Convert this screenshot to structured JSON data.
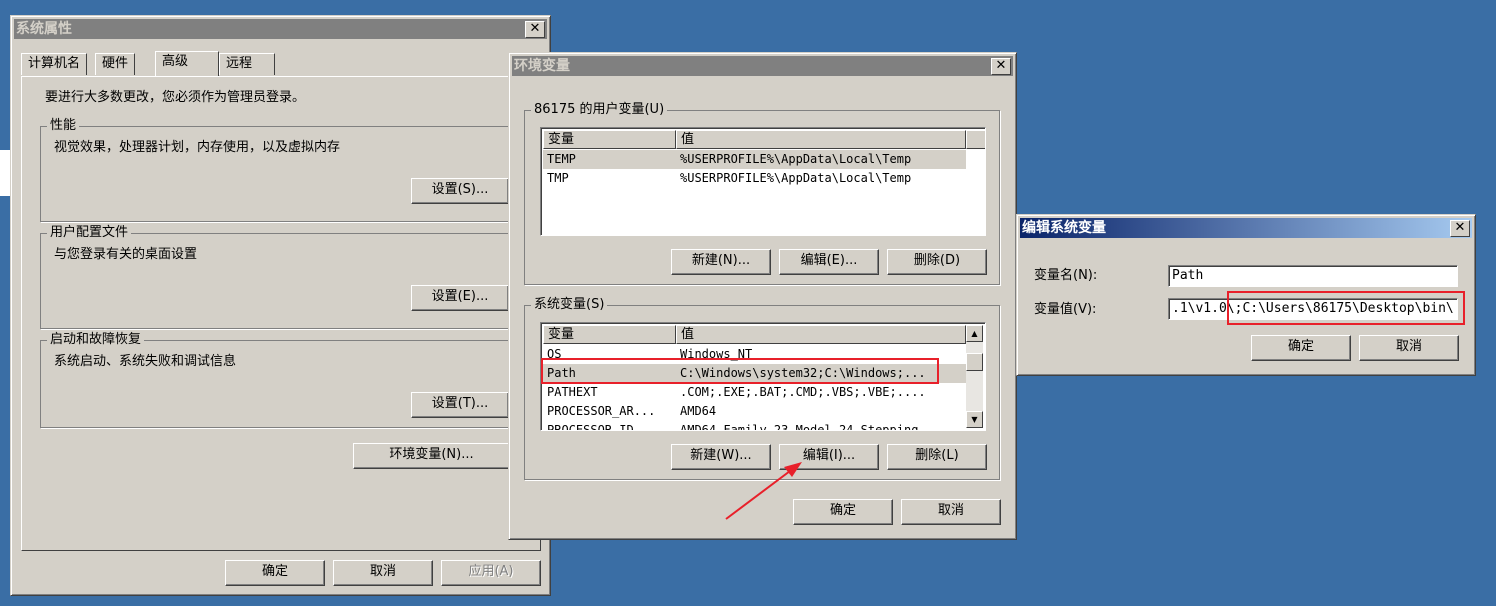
{
  "sysprops": {
    "title": "系统属性",
    "tabs": [
      "计算机名",
      "硬件",
      "高级",
      "远程"
    ],
    "admin_note": "要进行大多数更改，您必须作为管理员登录。",
    "perf": {
      "label": "性能",
      "desc": "视觉效果，处理器计划，内存使用，以及虚拟内存",
      "button": "设置(S)..."
    },
    "profile": {
      "label": "用户配置文件",
      "desc": "与您登录有关的桌面设置",
      "button": "设置(E)..."
    },
    "startup": {
      "label": "启动和故障恢复",
      "desc": "系统启动、系统失败和调试信息",
      "button": "设置(T)..."
    },
    "envvars_button": "环境变量(N)...",
    "ok": "确定",
    "cancel": "取消",
    "apply": "应用(A)"
  },
  "envvars": {
    "title": "环境变量",
    "user_group": "86175 的用户变量(U)",
    "columns": [
      "变量",
      "值"
    ],
    "user_vars": [
      {
        "name": "TEMP",
        "value": "%USERPROFILE%\\AppData\\Local\\Temp"
      },
      {
        "name": "TMP",
        "value": "%USERPROFILE%\\AppData\\Local\\Temp"
      }
    ],
    "user_buttons": {
      "new": "新建(N)...",
      "edit": "编辑(E)...",
      "delete": "删除(D)"
    },
    "sys_group": "系统变量(S)",
    "sys_vars": [
      {
        "name": "OS",
        "value": "Windows_NT"
      },
      {
        "name": "Path",
        "value": "C:\\Windows\\system32;C:\\Windows;..."
      },
      {
        "name": "PATHEXT",
        "value": ".COM;.EXE;.BAT;.CMD;.VBS;.VBE;...."
      },
      {
        "name": "PROCESSOR_AR...",
        "value": "AMD64"
      },
      {
        "name": "PROCESSOR_ID...",
        "value": "AMD64 Family 23 Model 24 Stepping"
      }
    ],
    "sys_buttons": {
      "new": "新建(W)...",
      "edit": "编辑(I)...",
      "delete": "删除(L)"
    },
    "ok": "确定",
    "cancel": "取消"
  },
  "editvar": {
    "title": "编辑系统变量",
    "name_label": "变量名(N):",
    "name_value": "Path",
    "value_label": "变量值(V):",
    "value_value": ".1\\v1.0\\;C:\\Users\\86175\\Desktop\\bin\\",
    "ok": "确定",
    "cancel": "取消"
  },
  "colors": {
    "desktop": "#3a6ea5",
    "annotation": "#e8202a",
    "title_active": "#0a246a"
  }
}
